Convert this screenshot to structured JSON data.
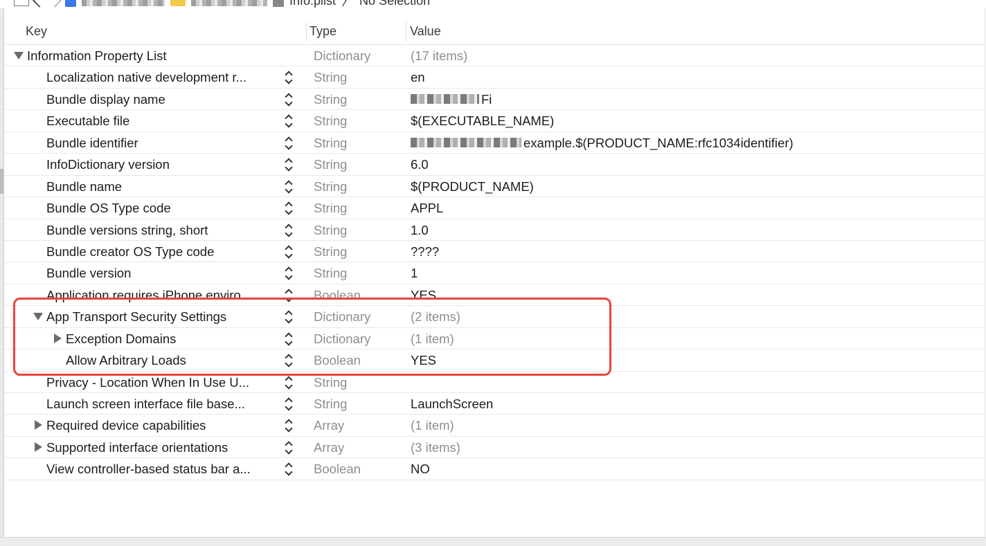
{
  "jumpbar": {
    "file": "Info.plist",
    "separator": "〉",
    "selection": "No Selection"
  },
  "columns": {
    "key": "Key",
    "type": "Type",
    "value": "Value"
  },
  "rows": [
    {
      "key": "Information Property List",
      "type": "Dictionary",
      "value": "(17 items)"
    },
    {
      "key": "Localization native development r...",
      "type": "String",
      "value": "en"
    },
    {
      "key": "Bundle display name",
      "type": "String",
      "value": "Fi"
    },
    {
      "key": "Executable file",
      "type": "String",
      "value": "$(EXECUTABLE_NAME)"
    },
    {
      "key": "Bundle identifier",
      "type": "String",
      "value": "example.$(PRODUCT_NAME:rfc1034identifier)"
    },
    {
      "key": "InfoDictionary version",
      "type": "String",
      "value": "6.0"
    },
    {
      "key": "Bundle name",
      "type": "String",
      "value": "$(PRODUCT_NAME)"
    },
    {
      "key": "Bundle OS Type code",
      "type": "String",
      "value": "APPL"
    },
    {
      "key": "Bundle versions string, short",
      "type": "String",
      "value": "1.0"
    },
    {
      "key": "Bundle creator OS Type code",
      "type": "String",
      "value": "????"
    },
    {
      "key": "Bundle version",
      "type": "String",
      "value": "1"
    },
    {
      "key": "Application requires iPhone enviro...",
      "type": "Boolean",
      "value": "YES"
    },
    {
      "key": "App Transport Security Settings",
      "type": "Dictionary",
      "value": "(2 items)"
    },
    {
      "key": "Exception Domains",
      "type": "Dictionary",
      "value": "(1 item)"
    },
    {
      "key": "Allow Arbitrary Loads",
      "type": "Boolean",
      "value": "YES"
    },
    {
      "key": "Privacy - Location When In Use U...",
      "type": "String",
      "value": ""
    },
    {
      "key": "Launch screen interface file base...",
      "type": "String",
      "value": "LaunchScreen"
    },
    {
      "key": "Required device capabilities",
      "type": "Array",
      "value": "(1 item)"
    },
    {
      "key": "Supported interface orientations",
      "type": "Array",
      "value": "(3 items)"
    },
    {
      "key": "View controller-based status bar a...",
      "type": "Boolean",
      "value": "NO"
    }
  ],
  "colors": {
    "highlight": "#e8453c",
    "dim_text": "#8e8e8e"
  }
}
